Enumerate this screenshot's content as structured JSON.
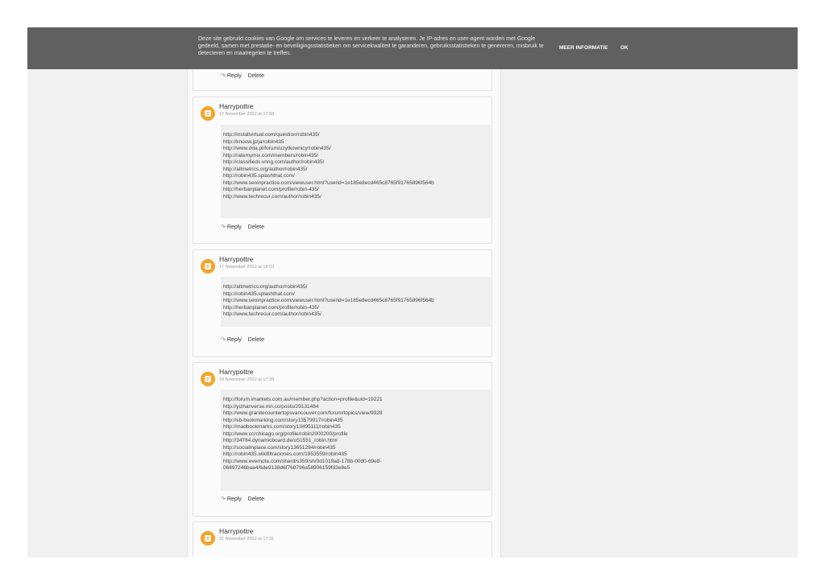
{
  "cookie_bar": {
    "text": "Deze site gebruikt cookies van Google om services te leveren en verkeer te analyseren. Je IP-adres en user-agent worden met Google gedeeld, samen met prestatie- en beveiligingsstatistieken om servicekwaliteit te garanderen, gebruiksstatistieken te genereren, misbruik te detecteren en maatregelen te treffen.",
    "more_info_label": "MEER INFORMATIE",
    "ok_label": "OK"
  },
  "labels": {
    "reply": "Reply",
    "delete": "Delete"
  },
  "icons": {
    "avatar": "blogger-icon",
    "reply": "reply-arrow-icon"
  },
  "colors": {
    "avatar": "#f7a42a",
    "cookie_bar": "#606060"
  },
  "comments": [
    {
      "author": "",
      "date": "",
      "links": []
    },
    {
      "author": "Harrypottre",
      "date": "17 November 2022 at 17:58",
      "links": [
        "http://installvirtual.com/question/robin435/",
        "http://knoow.jp/ja/robin435",
        "http://www.dda.pl/forum/uzytkownicy/robin435/",
        "http://ratemymix.com/members/robin435/",
        "http://classifieds.vnng.com/author/robin435/",
        "http://altmetrics.org/author/robin435/",
        "http://robin435.splashthat.com/",
        "http://www.seoinpractice.com/viewuser.html?userid=1e185e8ecd465c8765f91765896f564b",
        "http://herbanplanet.com/profile/robin-435/",
        "http://www.techrecur.com/author/robin435/"
      ]
    },
    {
      "author": "Harrypottre",
      "date": "17 November 2022 at 18:03",
      "links": [
        "http://altmetrics.org/author/robin435/",
        "http://robin435.splashthat.com/",
        "http://www.seoinpractice.com/viewuser.html?userid=1e185e8ecd465c8765f91765896f564b",
        "http://herbanplanet.com/profile/robin-435/",
        "http://www.techrecur.com/author/robin435/"
      ]
    },
    {
      "author": "Harrypottre",
      "date": "18 November 2022 at 17:39",
      "links": [
        "http://forum.imarkets.com.au/member.php?action=profile&uid=19221",
        "http://yizhanverse.mn.co/posts/29131484",
        "http://www.granitecountertopsvancouver.com/forum/topics/view/9928",
        "http://sb-bookmarking.com/story13579917/robin435",
        "http://madbookmarks.com/story13495111/robin435",
        "http://www.ccrchicago.org/profile/robin2000200/profile",
        "http://34784.dynamicboard.de/u51551_robin.html",
        "http://socialinplace.com/story13651294/robin435",
        "http://robin435.wikifiltraciones.com/1953559/robin435",
        "http://www.evernote.com/shard/s359/sh/0d1019ad-178b-00d0-69e8-",
        "06897246baa4/6de9138d6f760796a58906159fd3e8e5"
      ]
    },
    {
      "author": "Harrypottre",
      "date": "21 November 2022 at 17:31",
      "links": []
    }
  ]
}
